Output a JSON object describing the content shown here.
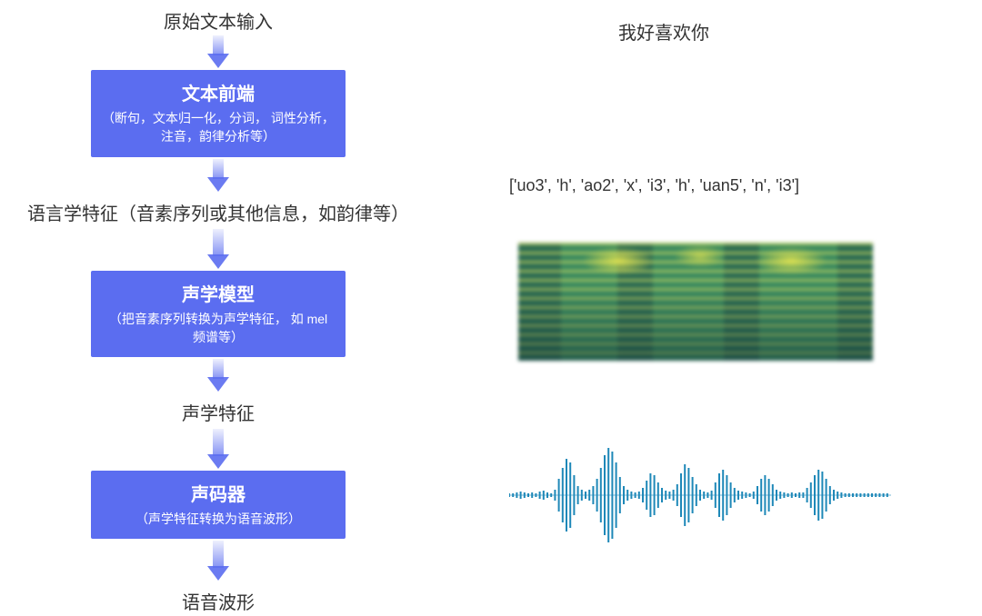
{
  "pipeline": {
    "input_label": "原始文本输入",
    "stage1": {
      "title": "文本前端",
      "desc": "（断句，文本归一化，分词，\n词性分析，注音，韵律分析等）"
    },
    "mid_label1": "语言学特征（音素序列或其他信息，如韵律等）",
    "stage2": {
      "title": "声学模型",
      "desc": "（把音素序列转换为声学特征，\n如 mel 频谱等）"
    },
    "mid_label2": "声学特征",
    "stage3": {
      "title": "声码器",
      "desc": "（声学特征转换为语音波形）"
    },
    "output_label": "语音波形"
  },
  "example": {
    "text_input": "我好喜欢你",
    "phoneme_sequence": "['uo3', 'h', 'ao2', 'x', 'i3', 'h', 'uan5', 'n', 'i3']"
  },
  "waveform_envelope": [
    2,
    2,
    3,
    4,
    3,
    2,
    3,
    2,
    4,
    5,
    3,
    2,
    6,
    18,
    30,
    40,
    36,
    22,
    10,
    6,
    4,
    6,
    10,
    18,
    30,
    44,
    52,
    48,
    36,
    20,
    10,
    6,
    4,
    3,
    4,
    8,
    16,
    24,
    22,
    14,
    8,
    5,
    4,
    6,
    12,
    24,
    34,
    30,
    20,
    12,
    6,
    4,
    3,
    5,
    14,
    24,
    28,
    22,
    14,
    8,
    5,
    4,
    3,
    2,
    4,
    10,
    18,
    22,
    18,
    12,
    6,
    4,
    3,
    2,
    3,
    2,
    3,
    3,
    8,
    14,
    22,
    28,
    26,
    18,
    10,
    6,
    4,
    3,
    2,
    2,
    2,
    2,
    2,
    2,
    2,
    2,
    2,
    2,
    2,
    2
  ],
  "colors": {
    "box": "#5b6df0",
    "wave": "#1E88B8"
  }
}
